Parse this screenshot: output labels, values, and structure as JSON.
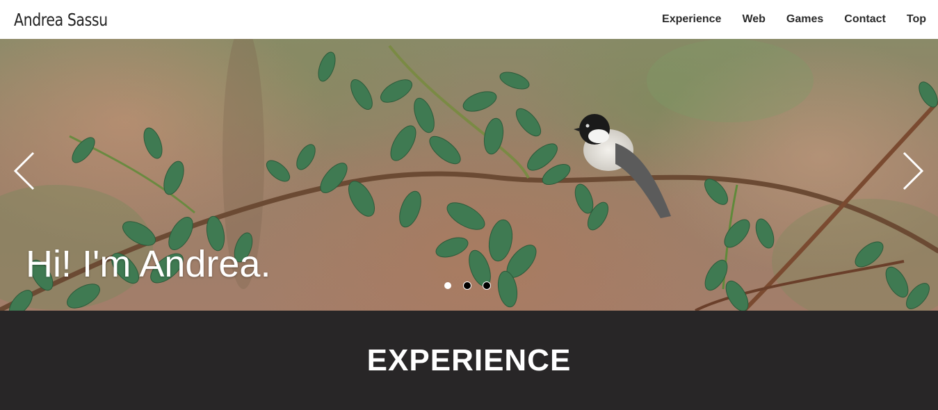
{
  "navbar": {
    "brand": "Andrea Sassu",
    "links": [
      "Experience",
      "Web",
      "Games",
      "Contact",
      "Top"
    ]
  },
  "hero": {
    "caption": "Hi! I'm Andrea.",
    "image_subject": "chickadee bird perched on rose branch",
    "slide_count": 3,
    "active_slide": 1,
    "prev_icon": "chevron-left-icon",
    "next_icon": "chevron-right-icon"
  },
  "section": {
    "title": "EXPERIENCE"
  },
  "colors": {
    "navbar_bg": "#ffffff",
    "nav_text": "#2a2a2a",
    "section_bg": "#282627",
    "caption_text": "#ffffff"
  }
}
